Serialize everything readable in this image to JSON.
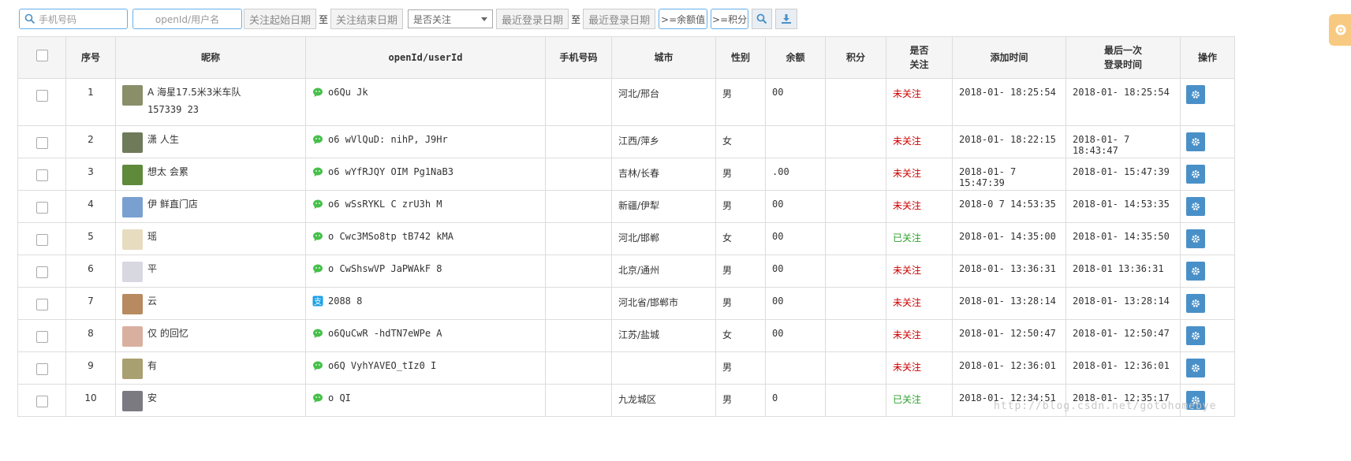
{
  "toolbar": {
    "phone_placeholder": "手机号码",
    "openid_placeholder": "openId/用户名",
    "follow_start_date": "关注起始日期",
    "to_1": "至",
    "follow_end_date": "关注结束日期",
    "follow_select_value": "是否关注",
    "login_start_date": "最近登录日期",
    "to_2": "至",
    "login_end_date": "最近登录日期",
    "balance_btn": ">=余额值",
    "points_btn": ">=积分",
    "search_icon": "search-icon",
    "download_icon": "download-icon"
  },
  "table": {
    "headers": {
      "no": "序号",
      "nickname": "昵称",
      "openid": "openId/userId",
      "phone": "手机号码",
      "city": "城市",
      "gender": "性别",
      "balance": "余额",
      "points": "积分",
      "follow_l1": "是否",
      "follow_l2": "关注",
      "added": "添加时间",
      "last_l1": "最后一次",
      "last_l2": "登录时间",
      "action": "操作"
    },
    "rows": [
      {
        "no": "1",
        "nick": "A  海星17.5米3米车队",
        "nick2": "157339   23",
        "oid": "o6Qu                    Jk",
        "oid_icon": "wechat",
        "phone": "",
        "city": "河北/邢台",
        "gender": "男",
        "balance": "00",
        "points": "",
        "follow": "未关注",
        "follow_state": "no",
        "added": "2018-01-   18:25:54",
        "last": "2018-01-   18:25:54"
      },
      {
        "no": "2",
        "nick": "潇  人生",
        "nick2": "",
        "oid": "o6   wVlQuD:  nihP,  J9Hr",
        "oid_icon": "wechat",
        "phone": "",
        "city": "江西/萍乡",
        "gender": "女",
        "balance": "",
        "points": "",
        "follow": "未关注",
        "follow_state": "no",
        "added": "2018-01-   18:22:15",
        "last": "2018-01-  7 18:43:47"
      },
      {
        "no": "3",
        "nick": "想太  会累",
        "nick2": "",
        "oid": "o6   wYfRJQY   OIM  Pg1NaB3",
        "oid_icon": "wechat",
        "phone": "",
        "city": "吉林/长春",
        "gender": "男",
        "balance": ".00",
        "points": "",
        "follow": "未关注",
        "follow_state": "no",
        "added": "2018-01-  7 15:47:39",
        "last": "2018-01-   15:47:39"
      },
      {
        "no": "4",
        "nick": "伊  鲜直门店",
        "nick2": "",
        "oid": "o6   wSsRYKL    C  zrU3h  M",
        "oid_icon": "wechat",
        "phone": "",
        "city": "新疆/伊犁",
        "gender": "男",
        "balance": "00",
        "points": "",
        "follow": "未关注",
        "follow_state": "no",
        "added": "2018-0  7 14:53:35",
        "last": "2018-01-   14:53:35"
      },
      {
        "no": "5",
        "nick": "  瑶",
        "nick2": "",
        "oid": "o   Cwc3MSo8tp   tB742  kMA",
        "oid_icon": "wechat",
        "phone": "",
        "city": "河北/邯郸",
        "gender": "女",
        "balance": "00",
        "points": "",
        "follow": "已关注",
        "follow_state": "yes",
        "added": "2018-01-  14:35:00",
        "last": "2018-01-   14:35:50"
      },
      {
        "no": "6",
        "nick": "  平",
        "nick2": "",
        "oid": "o   CwShswVP    JaPWAkF  8",
        "oid_icon": "wechat",
        "phone": "",
        "city": "北京/通州",
        "gender": "男",
        "balance": "00",
        "points": "",
        "follow": "未关注",
        "follow_state": "no",
        "added": "2018-01-   13:36:31",
        "last": "2018-01   13:36:31"
      },
      {
        "no": "7",
        "nick": "  云",
        "nick2": "",
        "oid": "2088   8",
        "oid_icon": "alipay",
        "phone": "",
        "city": "河北省/邯郸市",
        "gender": "男",
        "balance": "00",
        "points": "",
        "follow": "未关注",
        "follow_state": "no",
        "added": "2018-01-  13:28:14",
        "last": "2018-01-   13:28:14"
      },
      {
        "no": "8",
        "nick": "仅  的回忆",
        "nick2": "",
        "oid": "o6QuCwR     -hdTN7eWPe  A",
        "oid_icon": "wechat",
        "phone": "",
        "city": "江苏/盐城",
        "gender": "女",
        "balance": "00",
        "points": "",
        "follow": "未关注",
        "follow_state": "no",
        "added": "2018-01-   12:50:47",
        "last": "2018-01-   12:50:47"
      },
      {
        "no": "9",
        "nick": "有",
        "nick2": "",
        "oid": "o6Q     VyhYAVEO_tIz0  I",
        "oid_icon": "wechat",
        "phone": "",
        "city": "",
        "gender": "男",
        "balance": "",
        "points": "",
        "follow": "未关注",
        "follow_state": "no",
        "added": "2018-01-  12:36:01",
        "last": "2018-01-  12:36:01"
      },
      {
        "no": "10",
        "nick": "  安",
        "nick2": "",
        "oid": "o              QI",
        "oid_icon": "wechat",
        "phone": "",
        "city": "九龙城区",
        "gender": "男",
        "balance": "0",
        "points": "",
        "follow": "已关注",
        "follow_state": "yes",
        "added": "2018-01-   12:34:51",
        "last": "2018-01-   12:35:17"
      }
    ]
  },
  "watermark": "http://blog.csdn.net/gotohomebye",
  "colors": {
    "subscribed": "#2ea02e",
    "unsubscribed": "#cc0000",
    "action_button": "#4a90c8",
    "input_border": "#66afe9",
    "side_tab": "#f8c981"
  }
}
